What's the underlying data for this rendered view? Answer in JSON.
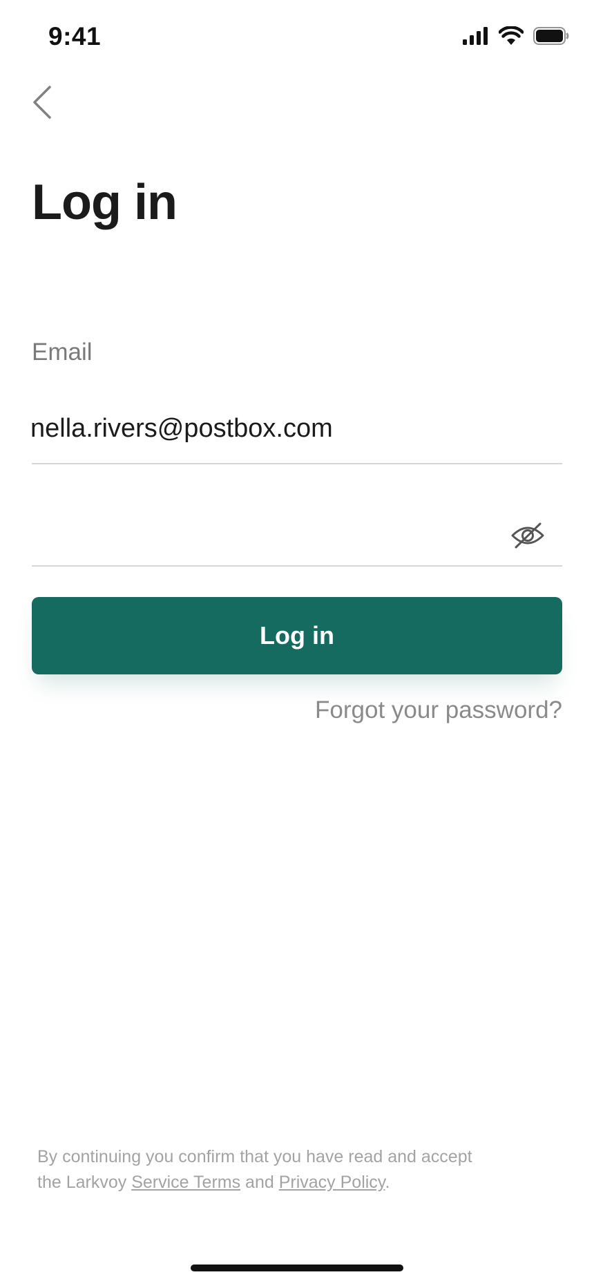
{
  "status_bar": {
    "time": "9:41",
    "icons": [
      "cellular-signal-icon",
      "wifi-icon",
      "battery-icon"
    ]
  },
  "nav": {
    "back_icon": "chevron-left-icon"
  },
  "title": "Log in",
  "email": {
    "label": "Email",
    "value": "nella.rivers@postbox.com"
  },
  "password": {
    "value": "",
    "toggle_icon": "eye-slash-icon"
  },
  "login_button": {
    "label": "Log in",
    "color": "#166b60"
  },
  "forgot_password": "Forgot your password?",
  "legal": {
    "line1": "By continuing you confirm that you have read and accept",
    "prefix": "the Larkvoy ",
    "service_terms": "Service Terms",
    "and": " and ",
    "privacy_policy": "Privacy Policy",
    "suffix": "."
  }
}
